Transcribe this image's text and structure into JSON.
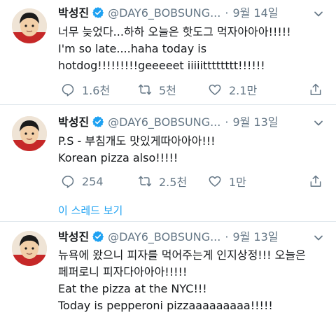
{
  "tweets": [
    {
      "name": "박성진",
      "handle": "@DAY6_BOBSUNG...",
      "dot": "·",
      "date": "9월 14일",
      "lines": [
        "너무 늦었다...하하 오늘은 핫도그 먹자아아아!!!!!",
        "I'm so late....haha today is",
        "hotdog!!!!!!!!!geeeeet iiiiitttttttt!!!!!!"
      ],
      "reply_count": "1.6천",
      "retweet_count": "5천",
      "like_count": "2.1만"
    },
    {
      "name": "박성진",
      "handle": "@DAY6_BOBSUNG...",
      "dot": "·",
      "date": "9월 13일",
      "lines": [
        "P.S - 부침개도 맛있게따아아아!!!",
        "Korean pizza also!!!!!"
      ],
      "reply_count": "254",
      "retweet_count": "2.5천",
      "like_count": "1만",
      "thread_link": "이 스레드 보기"
    },
    {
      "name": "박성진",
      "handle": "@DAY6_BOBSUNG...",
      "dot": "·",
      "date": "9월 13일",
      "lines": [
        "뉴욕에 왔으니 피자를 먹어주는게 인지상정!!! 오늘은",
        "페퍼로니 피자다아아아!!!!!",
        "Eat the pizza at the NYC!!!",
        "Today is pepperoni pizzaaaaaaaaa!!!!!"
      ]
    }
  ],
  "colors": {
    "accent": "#1da1f2",
    "muted": "#657786",
    "text": "#14171a",
    "divider": "#e1e8ed"
  },
  "icons": [
    "verified-badge-icon",
    "chevron-down-icon",
    "reply-icon",
    "retweet-icon",
    "like-icon",
    "share-icon"
  ]
}
